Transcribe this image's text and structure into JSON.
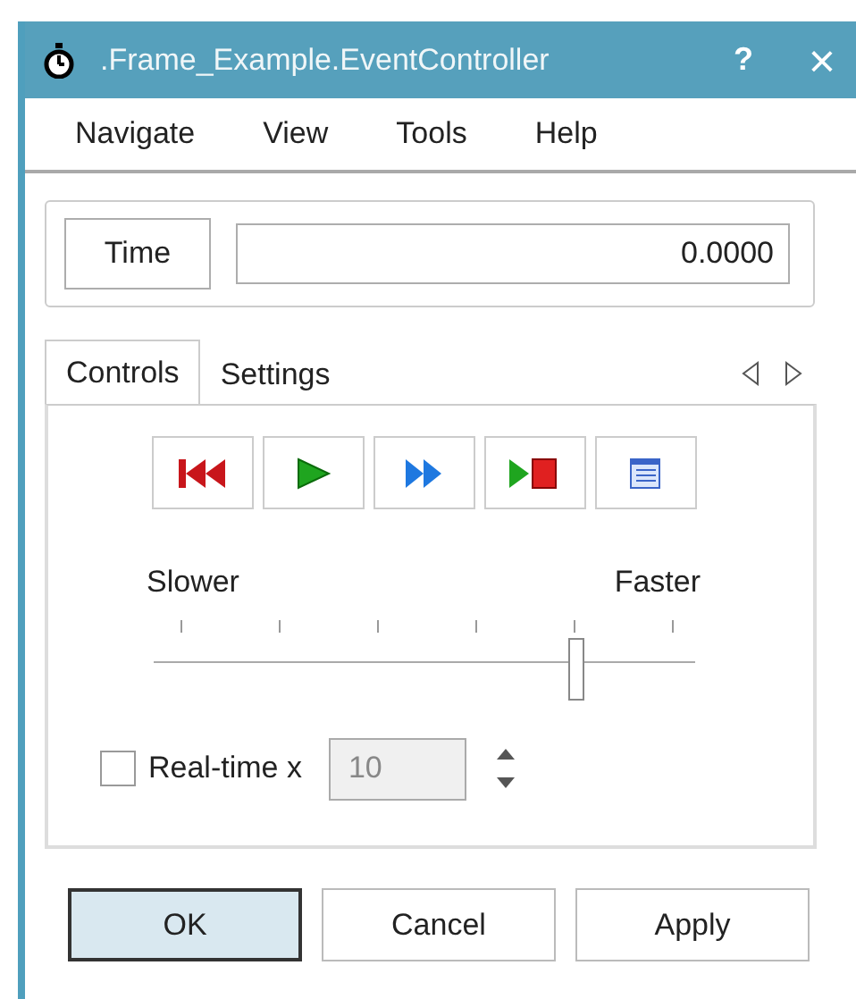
{
  "window": {
    "title": ".Frame_Example.EventController",
    "help": "?",
    "close": "×"
  },
  "menu": [
    "Navigate",
    "View",
    "Tools",
    "Help"
  ],
  "time": {
    "button": "Time",
    "value": "0.0000"
  },
  "tabs": [
    {
      "label": "Controls",
      "selected": true
    },
    {
      "label": "Settings",
      "selected": false
    }
  ],
  "toolbar": [
    {
      "kind": "rewind"
    },
    {
      "kind": "play"
    },
    {
      "kind": "fast-forward"
    },
    {
      "kind": "play-stop"
    },
    {
      "kind": "list"
    }
  ],
  "speed": {
    "min_label": "Slower",
    "max_label": "Faster",
    "level": 0.78
  },
  "realtime": {
    "label": "Real-time x",
    "checked": false,
    "value": "10"
  },
  "buttons": [
    {
      "label": "OK",
      "default": true
    },
    {
      "label": "Cancel",
      "default": false
    },
    {
      "label": "Apply",
      "default": false
    }
  ]
}
